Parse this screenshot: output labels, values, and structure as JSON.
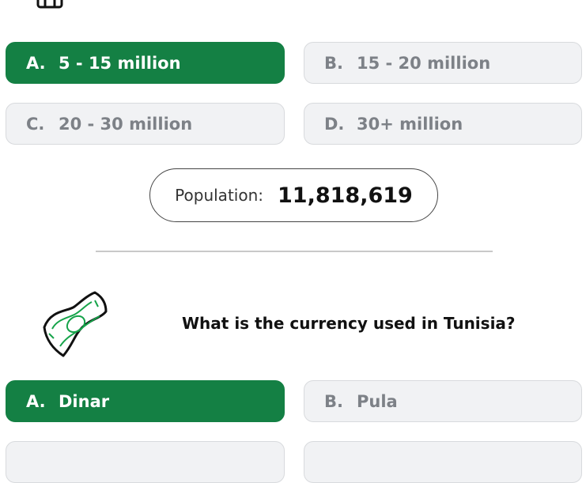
{
  "colors": {
    "correct": "#148044",
    "plain": "#f1f2f4",
    "plain_text": "#7d8187"
  },
  "top_icon": "suitcase-icon",
  "population_question": {
    "options": [
      {
        "letter": "A.",
        "text": "5 - 15 million",
        "state": "correct"
      },
      {
        "letter": "B.",
        "text": "15 - 20 million",
        "state": "plain"
      },
      {
        "letter": "C.",
        "text": "20 - 30 million",
        "state": "plain"
      },
      {
        "letter": "D.",
        "text": "30+ million",
        "state": "plain"
      }
    ],
    "population_label": "Population:",
    "population_value": "11,818,619"
  },
  "currency_question": {
    "icon": "money-bill-icon",
    "question": "What is the currency used in Tunisia?",
    "options": [
      {
        "letter": "A.",
        "text": "Dinar",
        "state": "correct"
      },
      {
        "letter": "B.",
        "text": "Pula",
        "state": "plain"
      }
    ]
  }
}
